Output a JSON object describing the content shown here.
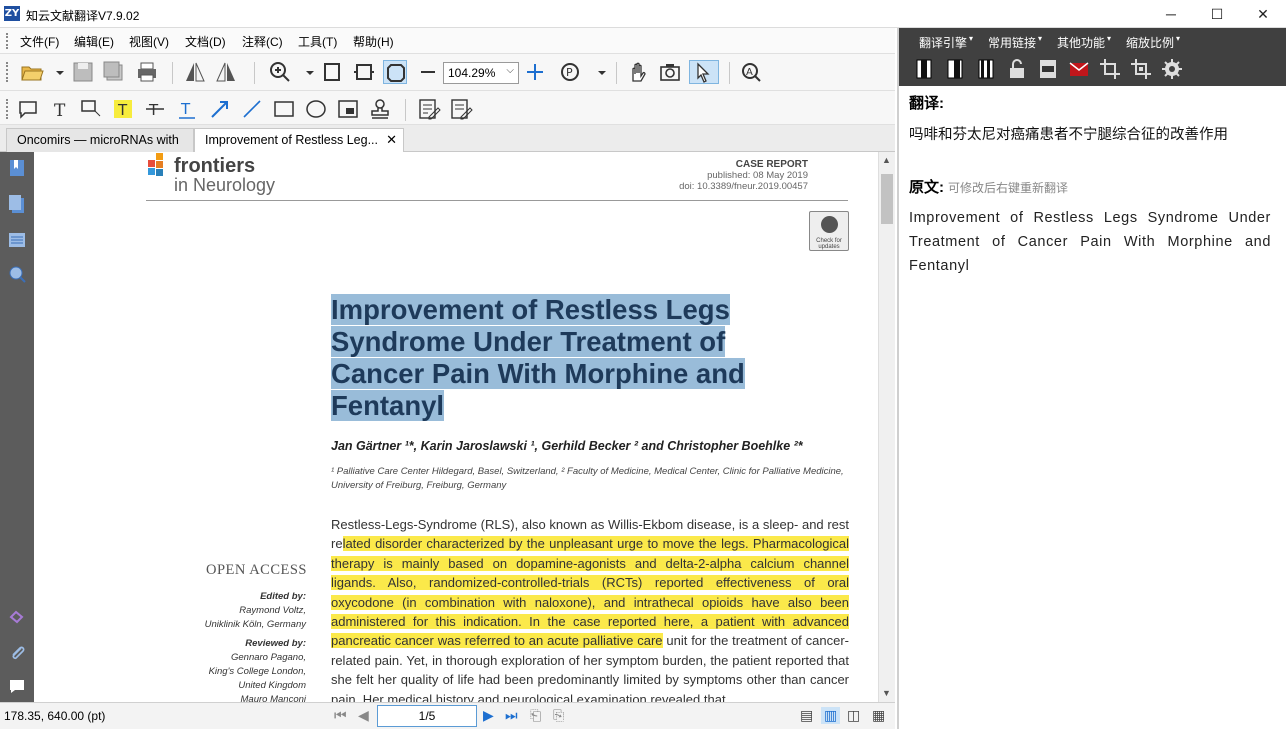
{
  "window": {
    "icon_label": "ZY",
    "title": "知云文献翻译V7.9.02",
    "minimize": "─",
    "maximize": "☐",
    "close": "✕"
  },
  "menu": [
    "文件(F)",
    "编辑(E)",
    "视图(V)",
    "文档(D)",
    "注释(C)",
    "工具(T)",
    "帮助(H)"
  ],
  "toolbar": {
    "zoom_value": "104.29%",
    "zoom_dropdown": "⌵"
  },
  "tabs": [
    {
      "label": "Oncomirs — microRNAs with",
      "active": false
    },
    {
      "label": "Improvement of Restless Leg...",
      "active": true
    }
  ],
  "tab_close": "✕",
  "document": {
    "journal_name_line1": "frontiers",
    "journal_name_line2": "in Neurology",
    "case_type": "CASE REPORT",
    "published": "published: 08 May 2019",
    "doi": "doi: 10.3389/fneur.2019.00457",
    "check_updates": "Check for updates",
    "title_lines": [
      "Improvement of Restless Legs",
      "Syndrome Under Treatment of",
      "Cancer Pain With Morphine and",
      "Fentanyl"
    ],
    "authors": "Jan Gärtner ¹*, Karin Jaroslawski ¹, Gerhild Becker ² and Christopher Boehlke ²*",
    "affiliation": "¹ Palliative Care Center Hildegard, Basel, Switzerland, ² Faculty of Medicine, Medical Center, Clinic for Palliative Medicine, University of Freiburg, Freiburg, Germany",
    "open_access": "OPEN ACCESS",
    "edited_by_label": "Edited by:",
    "edited_by_name": "Raymond Voltz,",
    "edited_by_inst": "Uniklinik Köln, Germany",
    "reviewed_by_label": "Reviewed by:",
    "reviewed_by_name": "Gennaro Pagano,",
    "reviewed_by_inst1": "King's College London,",
    "reviewed_by_inst2": "United Kingdom",
    "reviewed_by_name2": "Mauro Manconi",
    "body_plain_start": "Restless-Legs-Syndrome (RLS), also known as Willis-Ekbom disease, is a sleep- and rest re",
    "body_highlight": "lated disorder characterized by the unpleasant urge to move the legs. Pharmacological therapy is mainly based on dopamine-agonists and delta-2-alpha calcium channel ligands. Also, randomized-controlled-trials (RCTs) reported effectiveness of oral oxycodone (in combination with naloxone), and intrathecal opioids have also been administered for this indication. In the case reported here, a patient with advanced pancreatic cancer was referred to an acute palliative care",
    "body_plain_end": " unit for the treatment of cancer-related pain. Yet, in thorough exploration of her symptom burden, the patient reported that she felt her quality of life had been predominantly limited by symptoms other than cancer pain. Her medical history and neurological examination revealed that"
  },
  "status": {
    "coords": "178.35, 640.00 (pt)",
    "page": "1/5"
  },
  "right_panel": {
    "menus": [
      "翻译引擎",
      "常用链接",
      "其他功能",
      "缩放比例"
    ],
    "translation_label": "翻译:",
    "translation_text": "吗啡和芬太尼对癌痛患者不宁腿综合征的改善作用",
    "original_label": "原文:",
    "original_hint": "可修改后右键重新翻译",
    "original_text": "Improvement of Restless Legs Syndrome Under Treatment of Cancer Pain With Morphine and Fentanyl"
  },
  "colors": {
    "title_highlight": "#99bcd9",
    "text_highlight": "#fbe94a",
    "right_toolbar_bg": "#404040",
    "left_sidebar_bg": "#5c5c5c"
  }
}
